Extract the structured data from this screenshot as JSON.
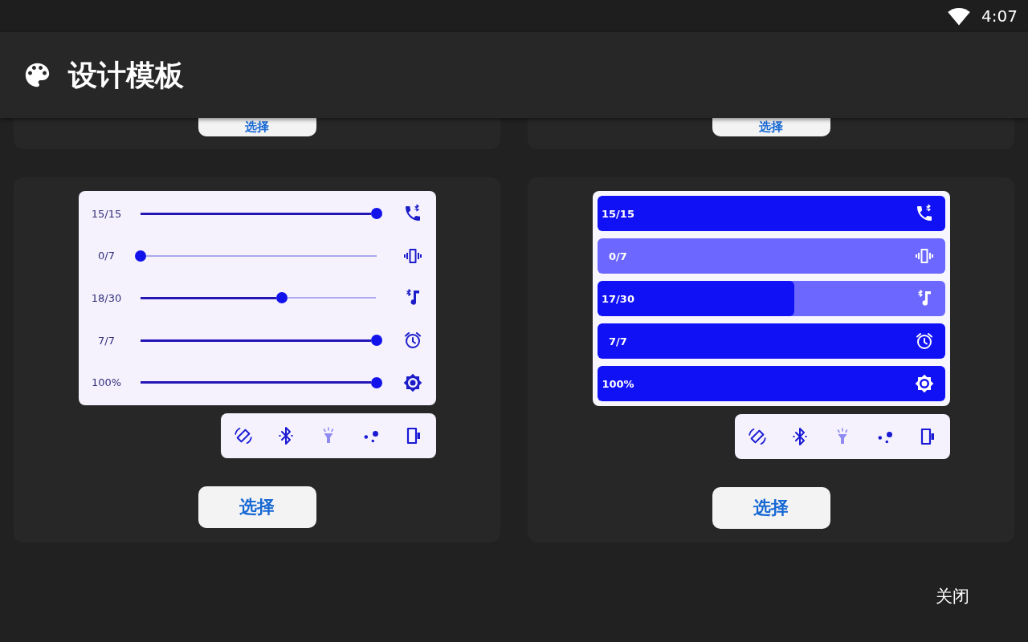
{
  "status_bar": {
    "time": "4:07"
  },
  "app_bar": {
    "title": "设计模板"
  },
  "templates": [
    {
      "kind": "clipped",
      "button": "选择"
    },
    {
      "kind": "clipped",
      "button": "选择"
    },
    {
      "kind": "slider",
      "sliders": [
        {
          "reading": "15/15",
          "level": 1
        },
        {
          "reading": "0/7",
          "level": 0
        },
        {
          "reading": "18/30",
          "level": 0.6
        },
        {
          "reading": "7/7",
          "level": 1
        },
        {
          "reading": "100%",
          "level": 1
        }
      ],
      "toggles": [
        {
          "on": true
        },
        {
          "on": true
        },
        {
          "on": false
        },
        {
          "on": true
        },
        {
          "on": true
        }
      ],
      "button": "选择"
    },
    {
      "kind": "bar",
      "sliders": [
        {
          "reading": "15/15",
          "level": 1
        },
        {
          "reading": "0/7",
          "level": 0
        },
        {
          "reading": "17/30",
          "level": 0.567
        },
        {
          "reading": "7/7",
          "level": 1
        },
        {
          "reading": "100%",
          "level": 1
        }
      ],
      "toggles": [
        {
          "on": true
        },
        {
          "on": true
        },
        {
          "on": false
        },
        {
          "on": true
        },
        {
          "on": true
        }
      ],
      "button": "选择"
    }
  ],
  "close_button": "关闭"
}
